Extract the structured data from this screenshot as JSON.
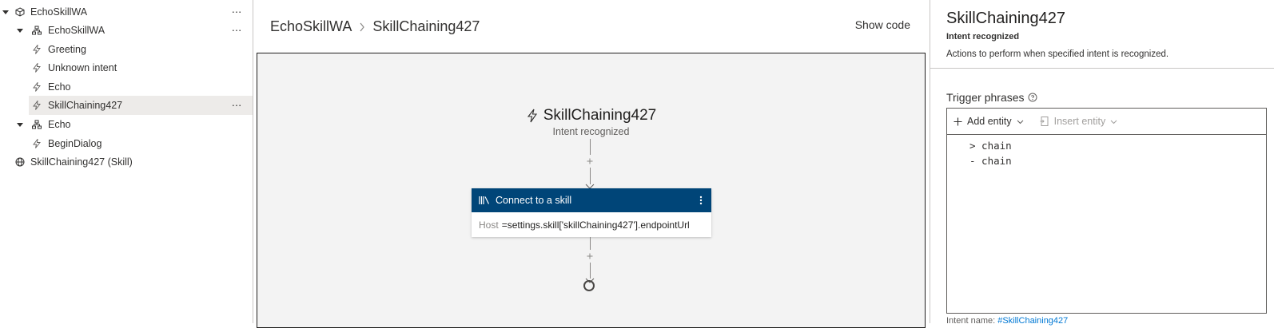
{
  "tree": {
    "items": [
      {
        "label": "EchoSkillWA",
        "icon": "cube-icon",
        "expanded": true,
        "more": true
      },
      {
        "label": "EchoSkillWA",
        "icon": "dialog-tree-icon",
        "expanded": true,
        "more": true
      },
      {
        "label": "Greeting",
        "icon": "lightning-icon"
      },
      {
        "label": "Unknown intent",
        "icon": "lightning-icon"
      },
      {
        "label": "Echo",
        "icon": "lightning-icon"
      },
      {
        "label": "SkillChaining427",
        "icon": "lightning-icon",
        "selected": true,
        "more": true
      },
      {
        "label": "Echo",
        "icon": "dialog-tree-icon",
        "expanded": true
      },
      {
        "label": "BeginDialog",
        "icon": "lightning-icon"
      },
      {
        "label": "SkillChaining427 (Skill)",
        "icon": "globe-icon"
      }
    ],
    "more_glyph": "⋯"
  },
  "breadcrumb": {
    "items": [
      "EchoSkillWA",
      "SkillChaining427"
    ]
  },
  "show_code_label": "Show code",
  "canvas": {
    "trigger_title": "SkillChaining427",
    "trigger_subtitle": "Intent recognized",
    "node": {
      "title": "Connect to a skill",
      "property_key": "Host",
      "property_value": "=settings.skill['skillChaining427'].endpointUrl"
    }
  },
  "properties": {
    "title": "SkillChaining427",
    "subtitle": "Intent recognized",
    "description": "Actions to perform when specified intent is recognized.",
    "trigger_phrases_label": "Trigger phrases",
    "toolbar": {
      "add_entity": "Add entity",
      "insert_entity": "Insert entity"
    },
    "code_lines": [
      "> chain",
      "- chain"
    ],
    "intent_name_prefix": "Intent name:",
    "intent_name_value": "#SkillChaining427"
  },
  "colors": {
    "node_header": "#004578",
    "selected_row": "#edebe9",
    "canvas_bg": "#f3f3f3",
    "link": "#0078d4"
  }
}
